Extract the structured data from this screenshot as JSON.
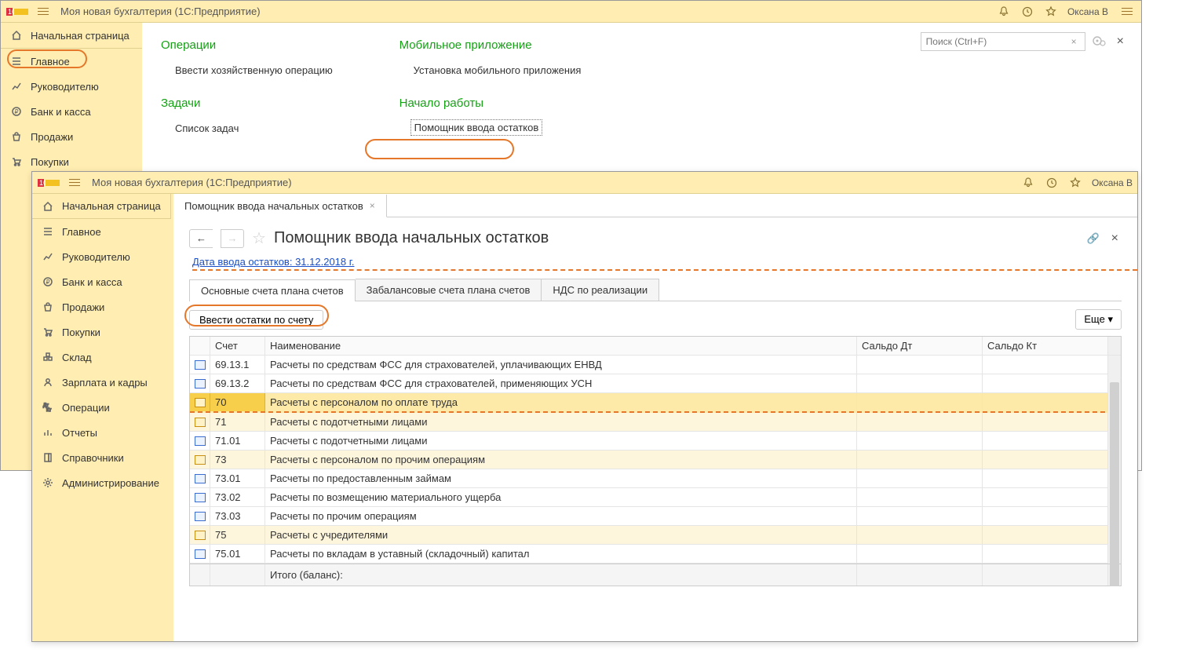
{
  "titlebar": {
    "app_title": "Моя новая бухгалтерия",
    "app_suffix": "  (1С:Предприятие)",
    "user": "Оксана В"
  },
  "sidebar_top": {
    "home_tab": "Начальная страница"
  },
  "sidebar": {
    "items": [
      {
        "label": "Главное",
        "icon": "menu"
      },
      {
        "label": "Руководителю",
        "icon": "chart"
      },
      {
        "label": "Банк и касса",
        "icon": "ruble"
      },
      {
        "label": "Продажи",
        "icon": "bag"
      },
      {
        "label": "Покупки",
        "icon": "cart"
      },
      {
        "label": "Склад",
        "icon": "boxes"
      },
      {
        "label": "Зарплата и кадры",
        "icon": "person"
      },
      {
        "label": "Операции",
        "icon": "dtkt"
      },
      {
        "label": "Отчеты",
        "icon": "bars"
      },
      {
        "label": "Справочники",
        "icon": "book"
      },
      {
        "label": "Администрирование",
        "icon": "gear"
      }
    ]
  },
  "search": {
    "placeholder": "Поиск (Ctrl+F)"
  },
  "sections": {
    "operations_title": "Операции",
    "operations_link": "Ввести хозяйственную операцию",
    "mobile_title": "Мобильное приложение",
    "mobile_link": "Установка мобильного приложения",
    "tasks_title": "Задачи",
    "tasks_link": "Список задач",
    "start_title": "Начало работы",
    "start_link": "Помощник ввода остатков"
  },
  "win2": {
    "tab_label": "Помощник ввода начальных остатков",
    "page_title": "Помощник ввода начальных остатков",
    "date_link": "Дата ввода остатков: 31.12.2018 г.",
    "subtabs": [
      "Основные счета плана счетов",
      "Забалансовые счета плана счетов",
      "НДС по реализации"
    ],
    "enter_btn": "Ввести остатки по счету",
    "more_btn": "Еще",
    "columns": {
      "acct": "Счет",
      "name": "Наименование",
      "dt": "Сальдо Дт",
      "kt": "Сальдо Кт"
    },
    "footer": "Итого (баланс):",
    "rows": [
      {
        "acct": "69.13.1",
        "name": "Расчеты по средствам ФСС для страхователей, уплачивающих ЕНВД",
        "y": false,
        "sel": false
      },
      {
        "acct": "69.13.2",
        "name": "Расчеты по средствам ФСС для страхователей, применяющих УСН",
        "y": false,
        "sel": false
      },
      {
        "acct": "70",
        "name": "Расчеты с персоналом по оплате труда",
        "y": true,
        "sel": true
      },
      {
        "acct": "71",
        "name": "Расчеты с подотчетными лицами",
        "y": true,
        "sel": false
      },
      {
        "acct": "71.01",
        "name": "Расчеты с подотчетными лицами",
        "y": false,
        "sel": false
      },
      {
        "acct": "73",
        "name": "Расчеты с персоналом по прочим операциям",
        "y": true,
        "sel": false
      },
      {
        "acct": "73.01",
        "name": "Расчеты по предоставленным займам",
        "y": false,
        "sel": false
      },
      {
        "acct": "73.02",
        "name": "Расчеты по возмещению материального ущерба",
        "y": false,
        "sel": false
      },
      {
        "acct": "73.03",
        "name": "Расчеты по прочим операциям",
        "y": false,
        "sel": false
      },
      {
        "acct": "75",
        "name": "Расчеты с учредителями",
        "y": true,
        "sel": false
      },
      {
        "acct": "75.01",
        "name": "Расчеты по вкладам в уставный (складочный) капитал",
        "y": false,
        "sel": false
      }
    ]
  }
}
